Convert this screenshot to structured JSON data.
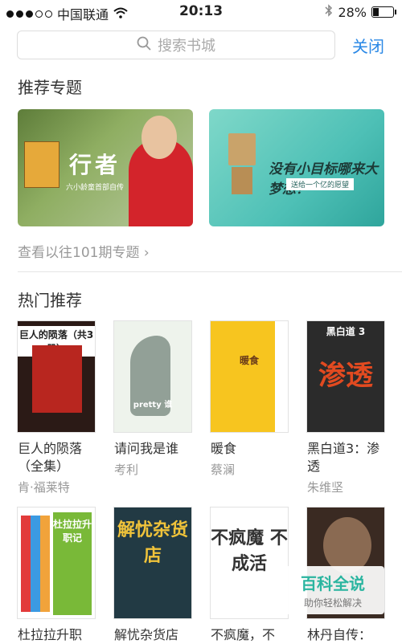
{
  "status_bar": {
    "carrier": "中国联通",
    "time": "20:13",
    "battery": "28%",
    "battery_level": 0.28
  },
  "search": {
    "placeholder": "搜索书城",
    "close_label": "关闭"
  },
  "topics": {
    "title": "推荐专题",
    "banners": [
      {
        "text": "行者",
        "sub": "六小龄童首部自传"
      },
      {
        "text": "没有小目标哪来大梦想？",
        "sub": "送给一个亿的愿望"
      }
    ],
    "more_link": "查看以往101期专题 ›"
  },
  "hot": {
    "title": "热门推荐",
    "books": [
      {
        "title": "巨人的陨落（全集）",
        "author": "肯·福莱特",
        "cover_text": "巨人的陨落（共3册）"
      },
      {
        "title": "请问我是谁",
        "author": "考利",
        "cover_text": "pretty 谁"
      },
      {
        "title": "暖食",
        "author": "蔡澜",
        "cover_text": "暖食"
      },
      {
        "title": "黑白道3：渗透",
        "author": "朱维坚",
        "cover_top": "黑白道 3",
        "cover_big": "渗透"
      },
      {
        "title": "杜拉拉升职",
        "cover_text": "杜拉拉升职记"
      },
      {
        "title": "解忧杂货店",
        "cover_text": "解忧杂货店"
      },
      {
        "title": "不疯魔，不",
        "cover_text": "不疯魔 不成活"
      },
      {
        "title": "林丹自传："
      }
    ]
  },
  "watermark": {
    "title": "百科全说",
    "sub": "助你轻松解决"
  }
}
